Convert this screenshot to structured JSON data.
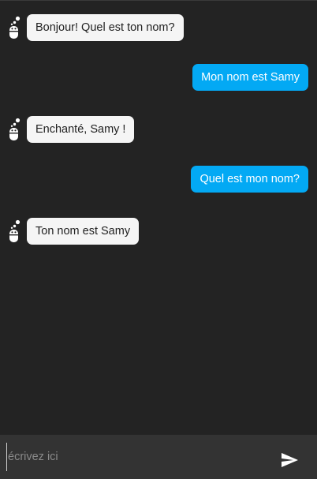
{
  "chat": {
    "messages": [
      {
        "sender": "bot",
        "text": "Bonjour! Quel est ton nom?"
      },
      {
        "sender": "user",
        "text": "Mon nom est Samy"
      },
      {
        "sender": "bot",
        "text": "Enchanté, Samy !"
      },
      {
        "sender": "user",
        "text": "Quel est mon nom?"
      },
      {
        "sender": "bot",
        "text": "Ton nom est Samy"
      }
    ]
  },
  "input": {
    "placeholder": "écrivez ici",
    "value": ""
  },
  "icons": {
    "bot_avatar": "robot-icon",
    "send": "send-icon"
  },
  "colors": {
    "background": "#232323",
    "bot_bubble": "#f5f5f5",
    "user_bubble": "#03a9f4",
    "input_bar": "#333333"
  }
}
